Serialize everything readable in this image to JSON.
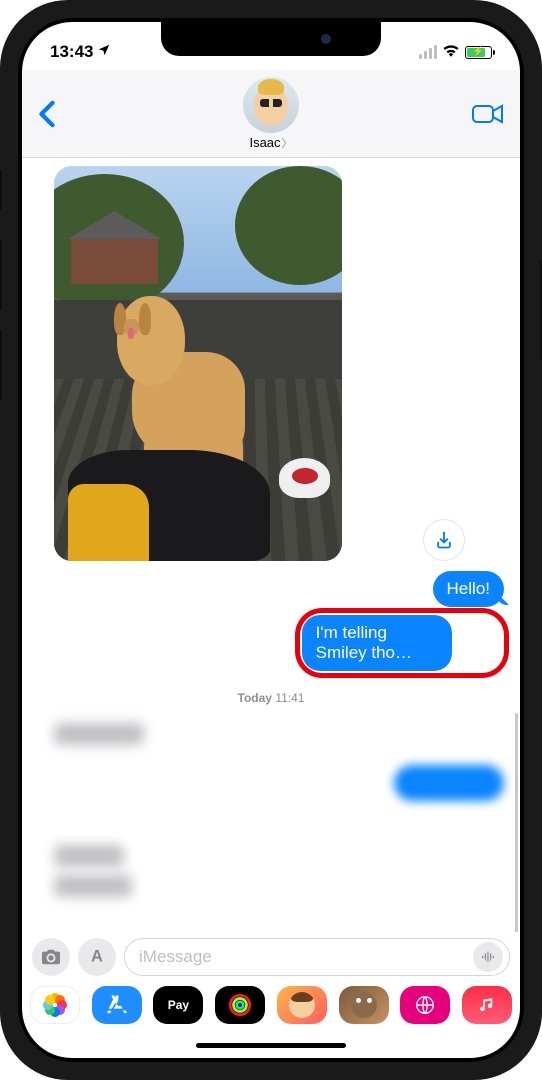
{
  "status": {
    "time": "13:43"
  },
  "header": {
    "contact_name": "Isaac"
  },
  "messages": {
    "sent1": "Hello!",
    "sent2": "I'm telling Smiley tho…",
    "timestamp_day": "Today",
    "timestamp_time": "11:41"
  },
  "input": {
    "placeholder": "iMessage"
  },
  "apps": {
    "pay_label": "Pay"
  },
  "icons": {
    "location": "location-arrow",
    "wifi": "wifi",
    "battery": "battery-charging"
  },
  "colors": {
    "imessage_blue": "#0a84ff",
    "ios_tint": "#007aff",
    "highlight_red": "#e8000d"
  }
}
